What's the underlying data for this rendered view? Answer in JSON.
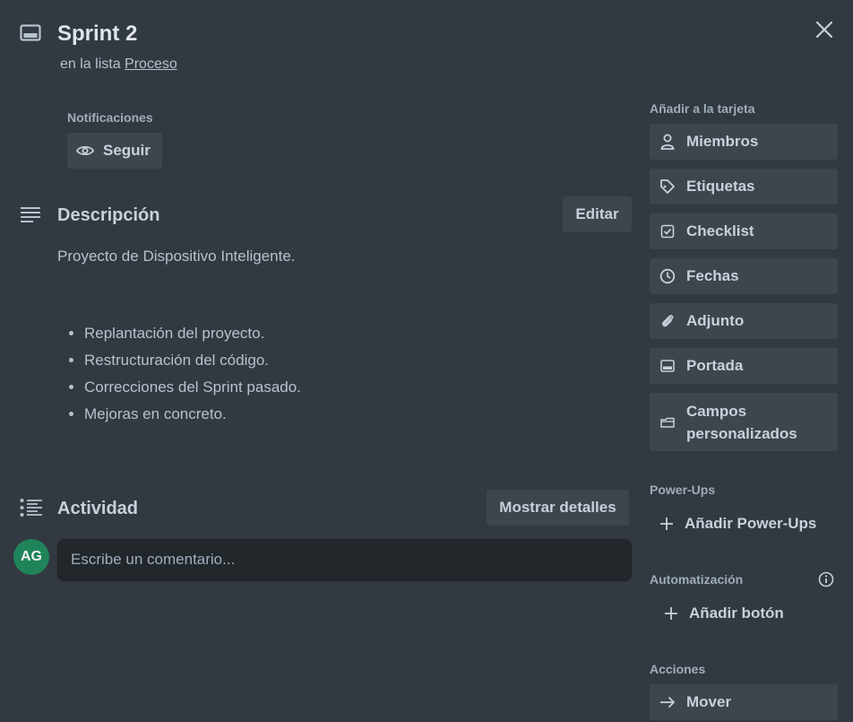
{
  "card": {
    "title": "Sprint 2",
    "list_prefix": "en la lista",
    "list_name": "Proceso"
  },
  "notifications": {
    "label": "Notificaciones",
    "follow_label": "Seguir"
  },
  "description": {
    "title": "Descripción",
    "edit_label": "Editar",
    "intro": "Proyecto de Dispositivo Inteligente.",
    "items": [
      "Replantación del proyecto.",
      "Restructuración del código.",
      "Correcciones del Sprint pasado.",
      "Mejoras en concreto."
    ]
  },
  "activity": {
    "title": "Actividad",
    "details_label": "Mostrar detalles",
    "avatar_initials": "AG",
    "comment_placeholder": "Escribe un comentario..."
  },
  "sidebar": {
    "add_label": "Añadir a la tarjeta",
    "buttons": [
      {
        "label": "Miembros",
        "icon": "person-icon"
      },
      {
        "label": "Etiquetas",
        "icon": "tag-icon"
      },
      {
        "label": "Checklist",
        "icon": "checkbox-icon"
      },
      {
        "label": "Fechas",
        "icon": "clock-icon"
      },
      {
        "label": "Adjunto",
        "icon": "paperclip-icon"
      },
      {
        "label": "Portada",
        "icon": "cover-icon"
      },
      {
        "label_line1": "Campos",
        "label_line2": "personalizados",
        "icon": "fields-icon"
      }
    ],
    "powerups_label": "Power-Ups",
    "add_powerups_label": "Añadir Power-Ups",
    "automation_label": "Automatización",
    "add_button_label": "Añadir botón",
    "actions_label": "Acciones",
    "move_label": "Mover"
  },
  "colors": {
    "background": "#323940",
    "button": "#3d454d",
    "avatar": "#1f845a",
    "text": "#b6c2cf"
  }
}
